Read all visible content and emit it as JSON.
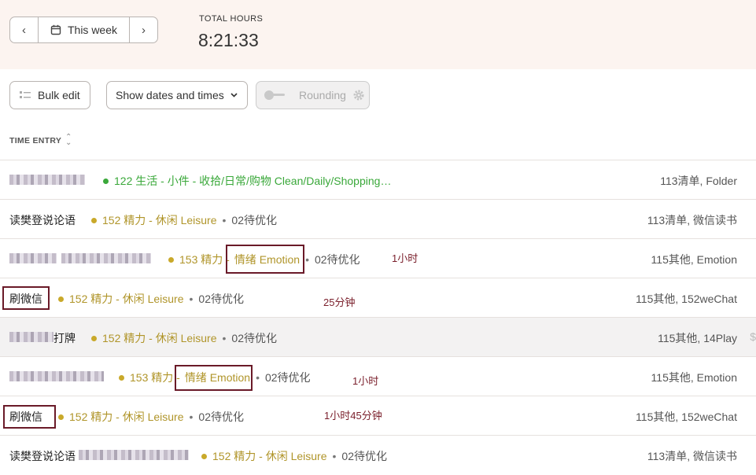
{
  "header": {
    "prev_icon": "chevron-left-icon",
    "week_label": "This week",
    "next_icon": "chevron-right-icon",
    "total_label": "TOTAL HOURS",
    "total_value": "8:21:33"
  },
  "toolbar": {
    "bulk_label": "Bulk edit",
    "show_label": "Show dates and times",
    "rounding_label": "Rounding"
  },
  "table": {
    "column_label": "TIME ENTRY",
    "rows": [
      {
        "desc": "",
        "project": "122 生活 - 小件 - 收拾/日常/购物 Clean/Daily/Shopping…",
        "project_color": "#3aa83a",
        "task": "",
        "tags": "113清单, Folder"
      },
      {
        "desc": "读樊登说论语",
        "project": "152 精力 - 休闲 Leisure",
        "project_color": "#c9a92a",
        "task": "02待优化",
        "tags": "113清单, 微信读书"
      },
      {
        "desc": "",
        "project_a": "153 精力 - ",
        "project_b": "情绪 Emotion",
        "project_color": "#c9a92a",
        "task": "02待优化",
        "tags": "115其他, Emotion",
        "note": "1小时"
      },
      {
        "desc": "刷微信",
        "project": "152 精力 - 休闲 Leisure",
        "project_color": "#c9a92a",
        "task": "02待优化",
        "tags": "115其他, 152weChat",
        "note": "25分钟"
      },
      {
        "desc": "打牌",
        "project": "152 精力 - 休闲 Leisure",
        "project_color": "#c9a92a",
        "task": "02待优化",
        "tags": "115其他, 14Play",
        "edge": "$"
      },
      {
        "desc": "",
        "project_a": "153 精力 - ",
        "project_b": "情绪 Emotion",
        "project_color": "#c9a92a",
        "task": "02待优化",
        "tags": "115其他, Emotion",
        "note": "1小时"
      },
      {
        "desc": "刷微信",
        "project": "152 精力 - 休闲 Leisure",
        "project_color": "#c9a92a",
        "task": "02待优化",
        "tags": "115其他, 152weChat",
        "note": "1小时45分钟"
      },
      {
        "desc": "读樊登说论语",
        "project": "152 精力 - 休闲 Leisure",
        "project_color": "#c9a92a",
        "task": "02待优化",
        "tags": "113清单, 微信读书"
      }
    ]
  }
}
